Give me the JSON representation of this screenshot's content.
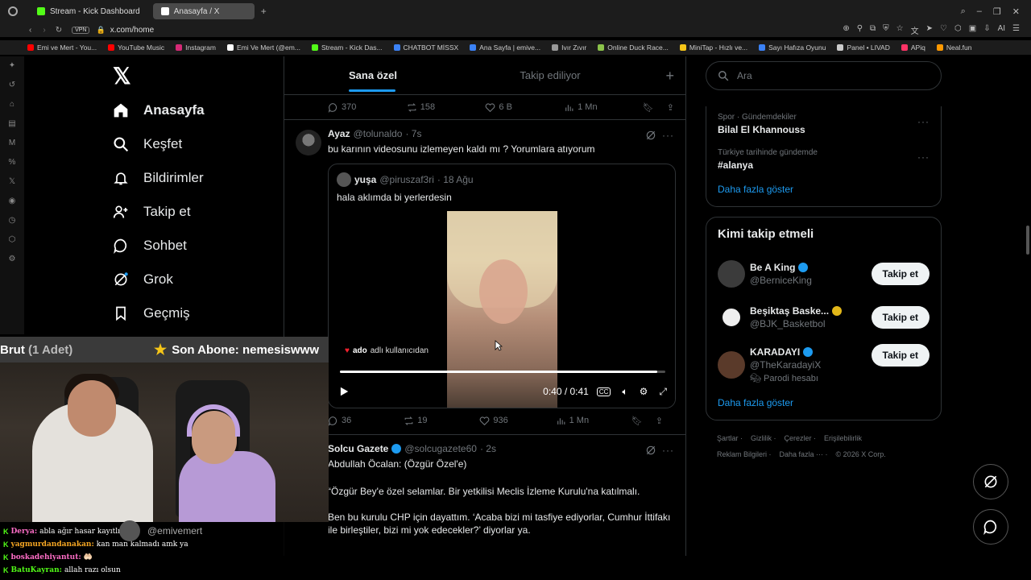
{
  "browser": {
    "tabs": [
      {
        "label": "Stream - Kick Dashboard",
        "color": "#53fc18"
      },
      {
        "label": "Anasayfa / X",
        "color": "#ffffff"
      }
    ],
    "vpn_label": "VPN",
    "url": "x.com/home",
    "ai_label": "AI",
    "bookmarks": [
      {
        "label": "Emi ve Mert - You...",
        "color": "#ff0000"
      },
      {
        "label": "YouTube Music",
        "color": "#ff0000"
      },
      {
        "label": "Instagram",
        "color": "#d62976"
      },
      {
        "label": "Emi Ve Mert (@em...",
        "color": "#ffffff"
      },
      {
        "label": "Stream - Kick Das...",
        "color": "#53fc18"
      },
      {
        "label": "CHATBOT MİSSX",
        "color": "#3b82f6"
      },
      {
        "label": "Ana Sayfa | emive...",
        "color": "#3b82f6"
      },
      {
        "label": "Ivır Zıvır",
        "color": "#999999"
      },
      {
        "label": "Online Duck Race...",
        "color": "#8bc34a"
      },
      {
        "label": "MiniTap - Hızlı ve...",
        "color": "#f5c518"
      },
      {
        "label": "Sayı Hafıza Oyunu",
        "color": "#3b82f6"
      },
      {
        "label": "Panel • LIVAD",
        "color": "#cccccc"
      },
      {
        "label": "APiq",
        "color": "#ff3366"
      },
      {
        "label": "Neal.fun",
        "color": "#ff9900"
      }
    ]
  },
  "nav": {
    "items": [
      {
        "label": "Anasayfa",
        "icon": "home-icon"
      },
      {
        "label": "Keşfet",
        "icon": "search-icon"
      },
      {
        "label": "Bildirimler",
        "icon": "bell-icon"
      },
      {
        "label": "Takip et",
        "icon": "follow-icon"
      },
      {
        "label": "Sohbet",
        "icon": "chat-icon"
      },
      {
        "label": "Grok",
        "icon": "grok-icon"
      },
      {
        "label": "Geçmiş",
        "icon": "bookmark-icon"
      }
    ]
  },
  "timeline": {
    "tabs": [
      "Sana özel",
      "Takip ediliyor"
    ],
    "prev_actions": {
      "replies": "370",
      "reposts": "158",
      "likes": "6 B",
      "views": "1 Mn"
    },
    "tweet1": {
      "name": "Ayaz",
      "handle": "@tolunaldo",
      "time": "· 7s",
      "text": "bu karının videosunu izlemeyen kaldı mı ? Yorumlara atıyorum",
      "quote": {
        "name": "yuşa",
        "handle": "@piruszaf3ri",
        "time": "· 18 Ağu",
        "text": "hala aklımda bi yerlerdesin",
        "video": {
          "overlay_user": "ado",
          "overlay_text": "adlı kullanıcıdan",
          "time": "0:40 / 0:41",
          "progress": 0.975
        }
      },
      "actions": {
        "replies": "36",
        "reposts": "19",
        "likes": "936",
        "views": "1 Mn"
      }
    },
    "tweet2": {
      "name": "Solcu Gazete",
      "handle": "@solcugazete60",
      "time": "· 2s",
      "text1": "Abdullah Öcalan: (Özgür Özel'e)",
      "text2": "“Özgür Bey'e özel selamlar. Bir yetkilisi Meclis İzleme Kurulu'na katılmalı.",
      "text3": "Ben bu kurulu CHP için dayattım. ‘Acaba bizi mi tasfiye ediyorlar, Cumhur İttifakı ile birleştiler, bizi mi yok edecekler?’ diyorlar ya."
    }
  },
  "right": {
    "search_placeholder": "Ara",
    "trends": [
      {
        "meta": "Spor · Gündemdekiler",
        "name": "Bilal El Khannouss"
      },
      {
        "meta": "Türkiye tarihinde gündemde",
        "name": "#alanya"
      }
    ],
    "show_more": "Daha fazla göster",
    "who_title": "Kimi takip etmeli",
    "who": [
      {
        "name": "Be A King",
        "handle": "@BerniceKing",
        "extra": "",
        "button": "Takip et"
      },
      {
        "name": "Beşiktaş Baske...",
        "handle": "@BJK_Basketbol",
        "extra": "",
        "button": "Takip et"
      },
      {
        "name": "KARADAYI",
        "handle": "@TheKaradayiX",
        "extra": "Parodi hesabı",
        "button": "Takip et"
      }
    ],
    "footer": [
      "Şartlar",
      "Gizlilik",
      "Çerezler",
      "Erişilebilirlik",
      "Reklam Bilgileri",
      "Daha fazla ···",
      "© 2026 X Corp."
    ]
  },
  "overlay": {
    "left_text": "Brut",
    "left_count": "(1 Adet)",
    "sub_label": "Son Abone: nemesiswww",
    "cam_name": "@emivemert",
    "chat": [
      {
        "user": "Derya:",
        "color": "#ff6ec7",
        "msg": "abla ağır hasar kayıtlı"
      },
      {
        "user": "yagmurdandanakan:",
        "color": "#f5a623",
        "msg": "kan man kalmadı amk ya"
      },
      {
        "user": "boskadehiyantut:",
        "color": "#ff6ec7",
        "msg": "🤲🏻"
      },
      {
        "user": "BatuKayran:",
        "color": "#53fc18",
        "msg": "allah razı olsun"
      }
    ]
  },
  "colors": {
    "accent": "#1d9bf0",
    "kick": "#53fc18"
  }
}
